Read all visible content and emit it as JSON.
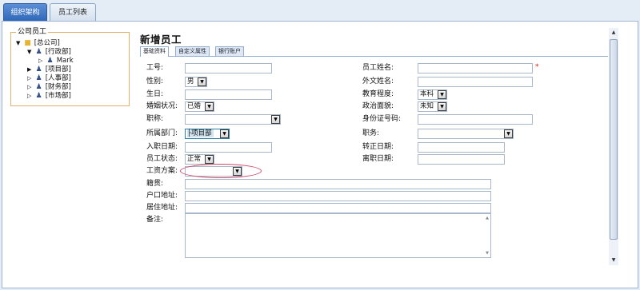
{
  "tabs": [
    {
      "label": "组织架构",
      "active": true
    },
    {
      "label": "员工列表",
      "active": false
    }
  ],
  "tree": {
    "legend": "公司员工",
    "root": "[总公司]",
    "nodes": {
      "admin": "[行政部]",
      "mark": "Mark",
      "project": "[项目部]",
      "hr": "[人事部]",
      "finance": "[财务部]",
      "market": "[市场部]"
    }
  },
  "form": {
    "title": "新增员工",
    "subtabs": [
      "基础资料",
      "自定义属性",
      "银行账户"
    ],
    "labels": {
      "emp_no": "工号:",
      "name": "员工姓名:",
      "gender": "性别:",
      "foreign_name": "外文姓名:",
      "birthday": "生日:",
      "education": "教育程度:",
      "marital": "婚姻状况:",
      "political": "政治面貌:",
      "job_title": "职称:",
      "id_card": "身份证号码:",
      "department": "所属部门:",
      "position": "职务:",
      "hire_date": "入职日期:",
      "regular_date": "转正日期:",
      "status": "员工状态:",
      "leave_date": "离职日期:",
      "salary_plan": "工资方案:",
      "native_place": "籍贯:",
      "household": "户口地址:",
      "residence": "居住地址:",
      "remark": "备注:"
    },
    "values": {
      "gender": "男",
      "education": "本科",
      "marital": "已婚",
      "political": "未知",
      "department": "├项目部",
      "status": "正常"
    },
    "required_mark": "*"
  }
}
